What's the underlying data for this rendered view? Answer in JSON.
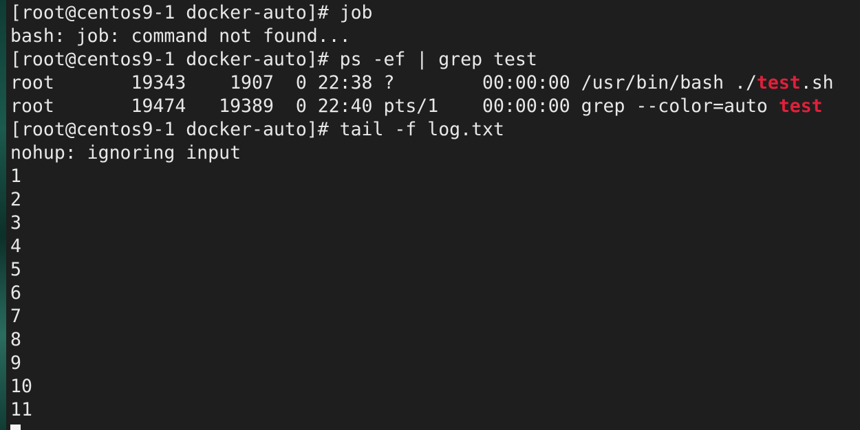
{
  "terminal": {
    "prompt": "[root@centos9-1 docker-auto]# ",
    "cmd_job": "job",
    "err_job": "bash: job: command not found...",
    "cmd_ps": "ps -ef | grep test",
    "ps_row1": {
      "prefix": "root       19343    1907  0 22:38 ?        00:00:00 /usr/bin/bash ./",
      "match": "test",
      "suffix": ".sh"
    },
    "ps_row2": {
      "prefix": "root       19474   19389  0 22:40 pts/1    00:00:00 grep --color=auto ",
      "match": "test"
    },
    "cmd_tail": "tail -f log.txt",
    "nohup_msg": "nohup: ignoring input",
    "log_lines": [
      "1",
      "2",
      "3",
      "4",
      "5",
      "6",
      "7",
      "8",
      "9",
      "10",
      "11"
    ],
    "match_color": "#e0203a"
  }
}
